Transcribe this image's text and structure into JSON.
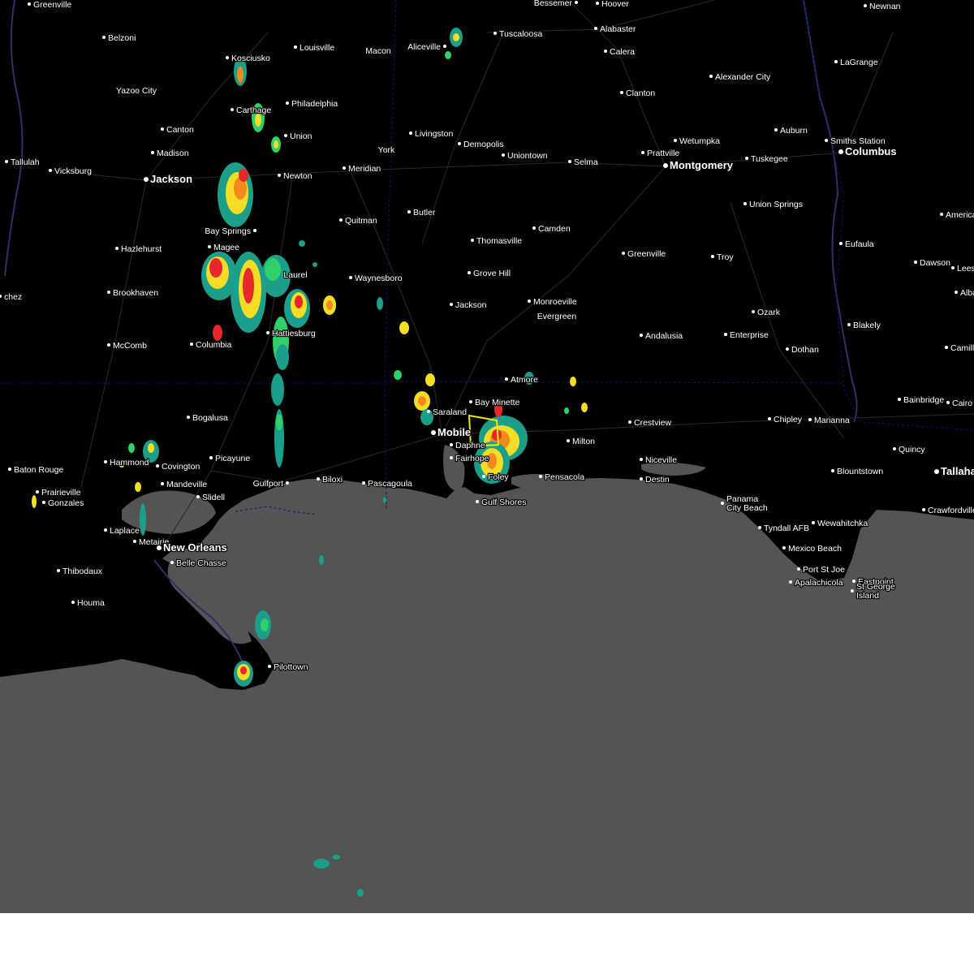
{
  "map": {
    "colors": {
      "land": "#000000",
      "water": "#545454",
      "border": "#101070",
      "road": "#2a2a2a",
      "river": "#303066",
      "warning_polygon": "#f2e40c",
      "radar_light": "#1b9e8a",
      "radar_mid": "#2fd06a",
      "radar_yellow": "#f5dc25",
      "radar_orange": "#f28a1e",
      "radar_red": "#e6282d"
    },
    "cities": [
      {
        "id": "greenville-ms",
        "name": "Greenville",
        "major": false
      },
      {
        "id": "bessemer",
        "name": "Bessemer",
        "major": false
      },
      {
        "id": "hoover",
        "name": "Hoover",
        "major": false
      },
      {
        "id": "newnan",
        "name": "Newnan",
        "major": false
      },
      {
        "id": "belzoni",
        "name": "Belzoni",
        "major": false
      },
      {
        "id": "louisville",
        "name": "Louisville",
        "major": false
      },
      {
        "id": "macon",
        "name": "Macon",
        "major": false
      },
      {
        "id": "aliceville",
        "name": "Aliceville",
        "major": false
      },
      {
        "id": "tuscaloosa",
        "name": "Tuscaloosa",
        "major": false
      },
      {
        "id": "alabaster",
        "name": "Alabaster",
        "major": false
      },
      {
        "id": "calera",
        "name": "Calera",
        "major": false
      },
      {
        "id": "lagrange",
        "name": "LaGrange",
        "major": false
      },
      {
        "id": "kosciusko",
        "name": "Kosciusko",
        "major": false
      },
      {
        "id": "yazoo-city",
        "name": "Yazoo City",
        "major": false
      },
      {
        "id": "alexander-city",
        "name": "Alexander City",
        "major": false
      },
      {
        "id": "clanton",
        "name": "Clanton",
        "major": false
      },
      {
        "id": "philadelphia",
        "name": "Philadelphia",
        "major": false
      },
      {
        "id": "carthage",
        "name": "Carthage",
        "major": false
      },
      {
        "id": "canton",
        "name": "Canton",
        "major": false
      },
      {
        "id": "union",
        "name": "Union",
        "major": false
      },
      {
        "id": "livingston",
        "name": "Livingston",
        "major": false
      },
      {
        "id": "auburn",
        "name": "Auburn",
        "major": false
      },
      {
        "id": "wetumpka",
        "name": "Wetumpka",
        "major": false
      },
      {
        "id": "smiths-station",
        "name": "Smiths Station",
        "major": false
      },
      {
        "id": "demopolis",
        "name": "Demopolis",
        "major": false
      },
      {
        "id": "madison",
        "name": "Madison",
        "major": false
      },
      {
        "id": "york",
        "name": "York",
        "major": false
      },
      {
        "id": "uniontown",
        "name": "Uniontown",
        "major": false
      },
      {
        "id": "prattville",
        "name": "Prattville",
        "major": false
      },
      {
        "id": "columbus",
        "name": "Columbus",
        "major": true
      },
      {
        "id": "tallulah",
        "name": "Tallulah",
        "major": false
      },
      {
        "id": "tuskegee",
        "name": "Tuskegee",
        "major": false
      },
      {
        "id": "selma",
        "name": "Selma",
        "major": false
      },
      {
        "id": "montgomery",
        "name": "Montgomery",
        "major": true
      },
      {
        "id": "vicksburg",
        "name": "Vicksburg",
        "major": false
      },
      {
        "id": "meridian",
        "name": "Meridian",
        "major": false
      },
      {
        "id": "newton",
        "name": "Newton",
        "major": false
      },
      {
        "id": "jackson-ms",
        "name": "Jackson",
        "major": true
      },
      {
        "id": "union-springs",
        "name": "Union Springs",
        "major": false
      },
      {
        "id": "butler",
        "name": "Butler",
        "major": false
      },
      {
        "id": "america",
        "name": "America",
        "major": false
      },
      {
        "id": "quitman",
        "name": "Quitman",
        "major": false
      },
      {
        "id": "camden",
        "name": "Camden",
        "major": false
      },
      {
        "id": "bay-springs",
        "name": "Bay Springs",
        "major": false
      },
      {
        "id": "thomasville",
        "name": "Thomasville",
        "major": false
      },
      {
        "id": "eufaula",
        "name": "Eufaula",
        "major": false
      },
      {
        "id": "hazlehurst",
        "name": "Hazlehurst",
        "major": false
      },
      {
        "id": "magee",
        "name": "Magee",
        "major": false
      },
      {
        "id": "greenville-al",
        "name": "Greenville",
        "major": false
      },
      {
        "id": "troy",
        "name": "Troy",
        "major": false
      },
      {
        "id": "dawson",
        "name": "Dawson",
        "major": false
      },
      {
        "id": "leesburg",
        "name": "Leesb",
        "major": false
      },
      {
        "id": "grove-hill",
        "name": "Grove Hill",
        "major": false
      },
      {
        "id": "laurel",
        "name": "Laurel",
        "major": false
      },
      {
        "id": "waynesboro",
        "name": "Waynesboro",
        "major": false
      },
      {
        "id": "natchez",
        "name": "chez",
        "major": false
      },
      {
        "id": "brookhaven",
        "name": "Brookhaven",
        "major": false
      },
      {
        "id": "albany",
        "name": "Alba",
        "major": false
      },
      {
        "id": "monroeville",
        "name": "Monroeville",
        "major": false
      },
      {
        "id": "jackson-al",
        "name": "Jackson",
        "major": false
      },
      {
        "id": "ozark",
        "name": "Ozark",
        "major": false
      },
      {
        "id": "evergreen",
        "name": "Evergreen",
        "major": false
      },
      {
        "id": "blakely",
        "name": "Blakely",
        "major": false
      },
      {
        "id": "hattiesburg",
        "name": "Hattiesburg",
        "major": false
      },
      {
        "id": "enterprise",
        "name": "Enterprise",
        "major": false
      },
      {
        "id": "andalusia",
        "name": "Andalusia",
        "major": false
      },
      {
        "id": "mccomb",
        "name": "McComb",
        "major": false
      },
      {
        "id": "columbia",
        "name": "Columbia",
        "major": false
      },
      {
        "id": "camilla",
        "name": "Camill",
        "major": false
      },
      {
        "id": "dothan",
        "name": "Dothan",
        "major": false
      },
      {
        "id": "atmore",
        "name": "Atmore",
        "major": false
      },
      {
        "id": "bainbridge",
        "name": "Bainbridge",
        "major": false
      },
      {
        "id": "cairo",
        "name": "Cairo",
        "major": false
      },
      {
        "id": "bay-minette",
        "name": "Bay Minette",
        "major": false
      },
      {
        "id": "saraland",
        "name": "Saraland",
        "major": false
      },
      {
        "id": "bogalusa",
        "name": "Bogalusa",
        "major": false
      },
      {
        "id": "chipley",
        "name": "Chipley",
        "major": false
      },
      {
        "id": "marianna",
        "name": "Marianna",
        "major": false
      },
      {
        "id": "crestview",
        "name": "Crestview",
        "major": false
      },
      {
        "id": "mobile",
        "name": "Mobile",
        "major": true
      },
      {
        "id": "milton",
        "name": "Milton",
        "major": false
      },
      {
        "id": "daphne",
        "name": "Daphne",
        "major": false
      },
      {
        "id": "quincy",
        "name": "Quincy",
        "major": false
      },
      {
        "id": "picayune",
        "name": "Picayune",
        "major": false
      },
      {
        "id": "hammond",
        "name": "Hammond",
        "major": false
      },
      {
        "id": "fairhope",
        "name": "Fairhope",
        "major": false
      },
      {
        "id": "niceville",
        "name": "Niceville",
        "major": false
      },
      {
        "id": "covington",
        "name": "Covington",
        "major": false
      },
      {
        "id": "baton-rouge",
        "name": "Baton Rouge",
        "major": false
      },
      {
        "id": "blountstown",
        "name": "Blountstown",
        "major": false
      },
      {
        "id": "tallahassee",
        "name": "Tallahas",
        "major": true
      },
      {
        "id": "pensacola",
        "name": "Pensacola",
        "major": false
      },
      {
        "id": "foley",
        "name": "Foley",
        "major": false
      },
      {
        "id": "biloxi",
        "name": "Biloxi",
        "major": false
      },
      {
        "id": "destin",
        "name": "Destin",
        "major": false
      },
      {
        "id": "prairieville",
        "name": "Prairieville",
        "major": false
      },
      {
        "id": "gulfport",
        "name": "Gulfport",
        "major": false
      },
      {
        "id": "mandeville",
        "name": "Mandeville",
        "major": false
      },
      {
        "id": "pascagoula",
        "name": "Pascagoula",
        "major": false
      },
      {
        "id": "slidell",
        "name": "Slidell",
        "major": false
      },
      {
        "id": "gonzales",
        "name": "Gonzales",
        "major": false
      },
      {
        "id": "gulf-shores",
        "name": "Gulf Shores",
        "major": false
      },
      {
        "id": "panama-city-beach",
        "name": "Panama City Beach",
        "major": false
      },
      {
        "id": "crawfordville",
        "name": "Crawfordville",
        "major": false
      },
      {
        "id": "tyndall-afb",
        "name": "Tyndall AFB",
        "major": false
      },
      {
        "id": "wewahitchka",
        "name": "Wewahitchka",
        "major": false
      },
      {
        "id": "laplace",
        "name": "Laplace",
        "major": false
      },
      {
        "id": "metairie",
        "name": "Metairie",
        "major": false
      },
      {
        "id": "new-orleans",
        "name": "New Orleans",
        "major": true
      },
      {
        "id": "mexico-beach",
        "name": "Mexico Beach",
        "major": false
      },
      {
        "id": "belle-chasse",
        "name": "Belle Chasse",
        "major": false
      },
      {
        "id": "port-st-joe",
        "name": "Port St Joe",
        "major": false
      },
      {
        "id": "thibodaux",
        "name": "Thibodaux",
        "major": false
      },
      {
        "id": "apalachicola",
        "name": "Apalachicola",
        "major": false
      },
      {
        "id": "eastpoint",
        "name": "Eastpoint",
        "major": false
      },
      {
        "id": "st-george-island",
        "name": "St George Island",
        "major": false
      },
      {
        "id": "houma",
        "name": "Houma",
        "major": false
      },
      {
        "id": "pilottown",
        "name": "Pilottown",
        "major": false
      }
    ]
  }
}
